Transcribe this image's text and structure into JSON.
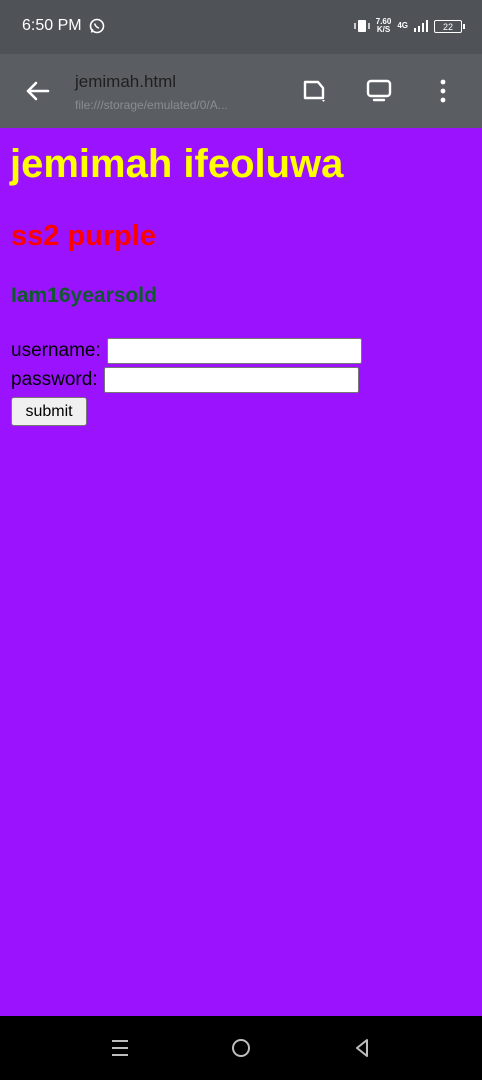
{
  "status_bar": {
    "time": "6:50 PM",
    "net_speed_value": "7.60",
    "net_speed_unit": "K/S",
    "network_type": "4G",
    "battery": "22",
    "icons": [
      "whatsapp-icon",
      "vibrate-icon",
      "signal-icon",
      "battery-icon"
    ]
  },
  "toolbar": {
    "title": "jemimah.html",
    "url": "file:///storage/emulated/0/A..."
  },
  "page": {
    "heading1": "jemimah ifeoluwa",
    "heading2": "ss2 purple",
    "heading3": "Iam16yearsold",
    "username_label": "username:",
    "username_value": "",
    "password_label": "password:",
    "password_value": "",
    "submit_label": "submit"
  },
  "colors": {
    "page_bg": "#9b13fe",
    "heading1": "#ffff00",
    "heading2": "#ff0000",
    "heading3": "#0d5a2c"
  }
}
